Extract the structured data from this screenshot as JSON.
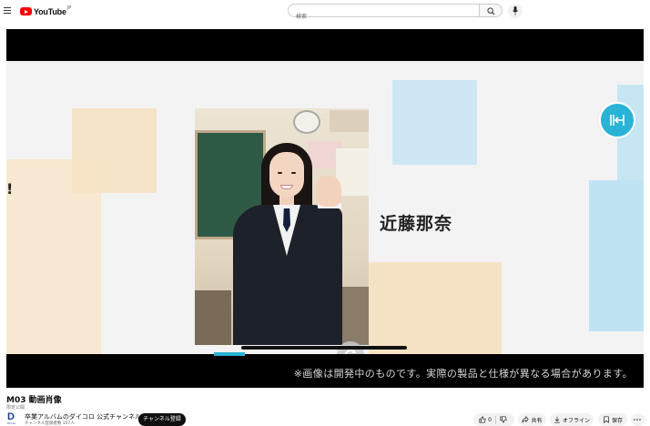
{
  "header": {
    "logo_text": "YouTube",
    "logo_region": "JP",
    "search_placeholder": "検索"
  },
  "video": {
    "name_overlay": "近藤那奈",
    "partial_char": "!",
    "disclaimer": "※画像は開発中のものです。実際の製品と仕様が異なる場合があります。",
    "accent_color": "#2ab3d6"
  },
  "info": {
    "title": "M03 動画肖像",
    "visibility": "限定公開"
  },
  "channel": {
    "logo_letter": "D",
    "logo_sub": "DIY-ko",
    "name": "卒業アルバムのダイコロ 公式チャンネル",
    "subscribers": "チャンネル登録者数 107人",
    "subscribe_label": "チャンネル登録"
  },
  "actions": {
    "like_count": "0",
    "share_label": "共有",
    "offline_label": "オフライン",
    "save_label": "保存"
  }
}
